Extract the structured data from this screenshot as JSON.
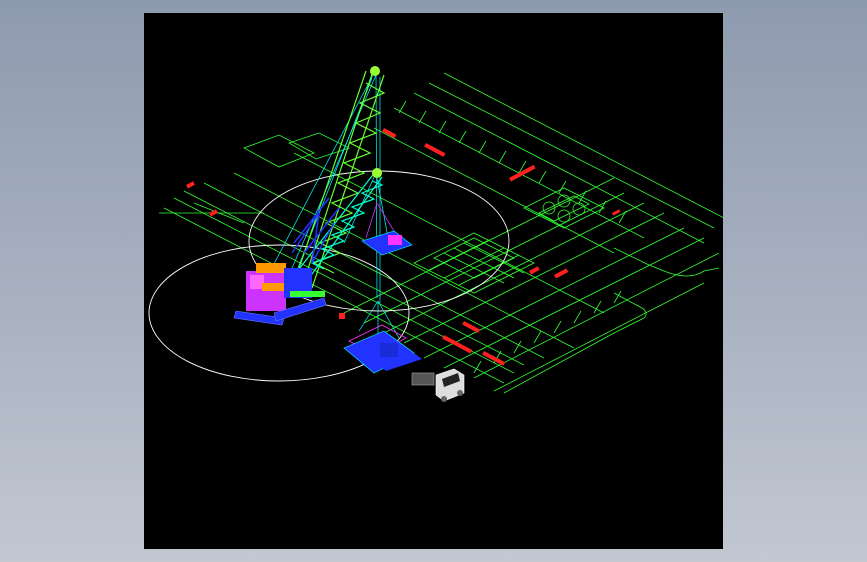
{
  "canvas": {
    "background": "#000000",
    "frame_background": "#9aa4b6"
  },
  "colors": {
    "plan_lines": "#33ff33",
    "annotations": "#ff2020",
    "swing_circle": "#ffffff",
    "boom_lattice": "#55ff55",
    "boom_lower": "#00ffcc",
    "carbody": "#2233ff",
    "counterweight": "#cc33ff",
    "machinery": "#ff9900",
    "rigging": "#00ffff"
  },
  "icons": {
    "crane": "crawler-crane-icon",
    "truck": "truck-icon",
    "load": "spreader-frame-icon"
  }
}
